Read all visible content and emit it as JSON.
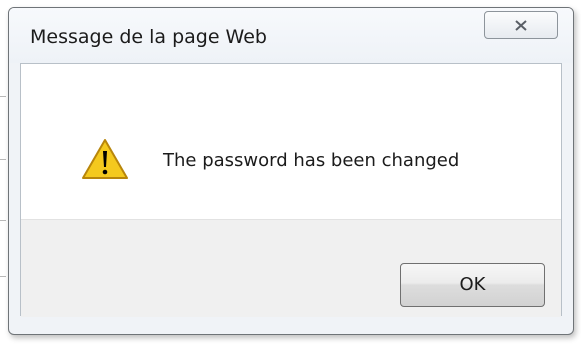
{
  "dialog": {
    "title": "Message de la page Web",
    "message": "The password has been changed",
    "ok_label": "OK",
    "icons": {
      "close": "close-icon",
      "message": "warning-icon"
    }
  },
  "colors": {
    "warning_fill": "#f4c91e",
    "warning_stroke": "#b8860b",
    "dialog_frame": "#6f7478"
  }
}
